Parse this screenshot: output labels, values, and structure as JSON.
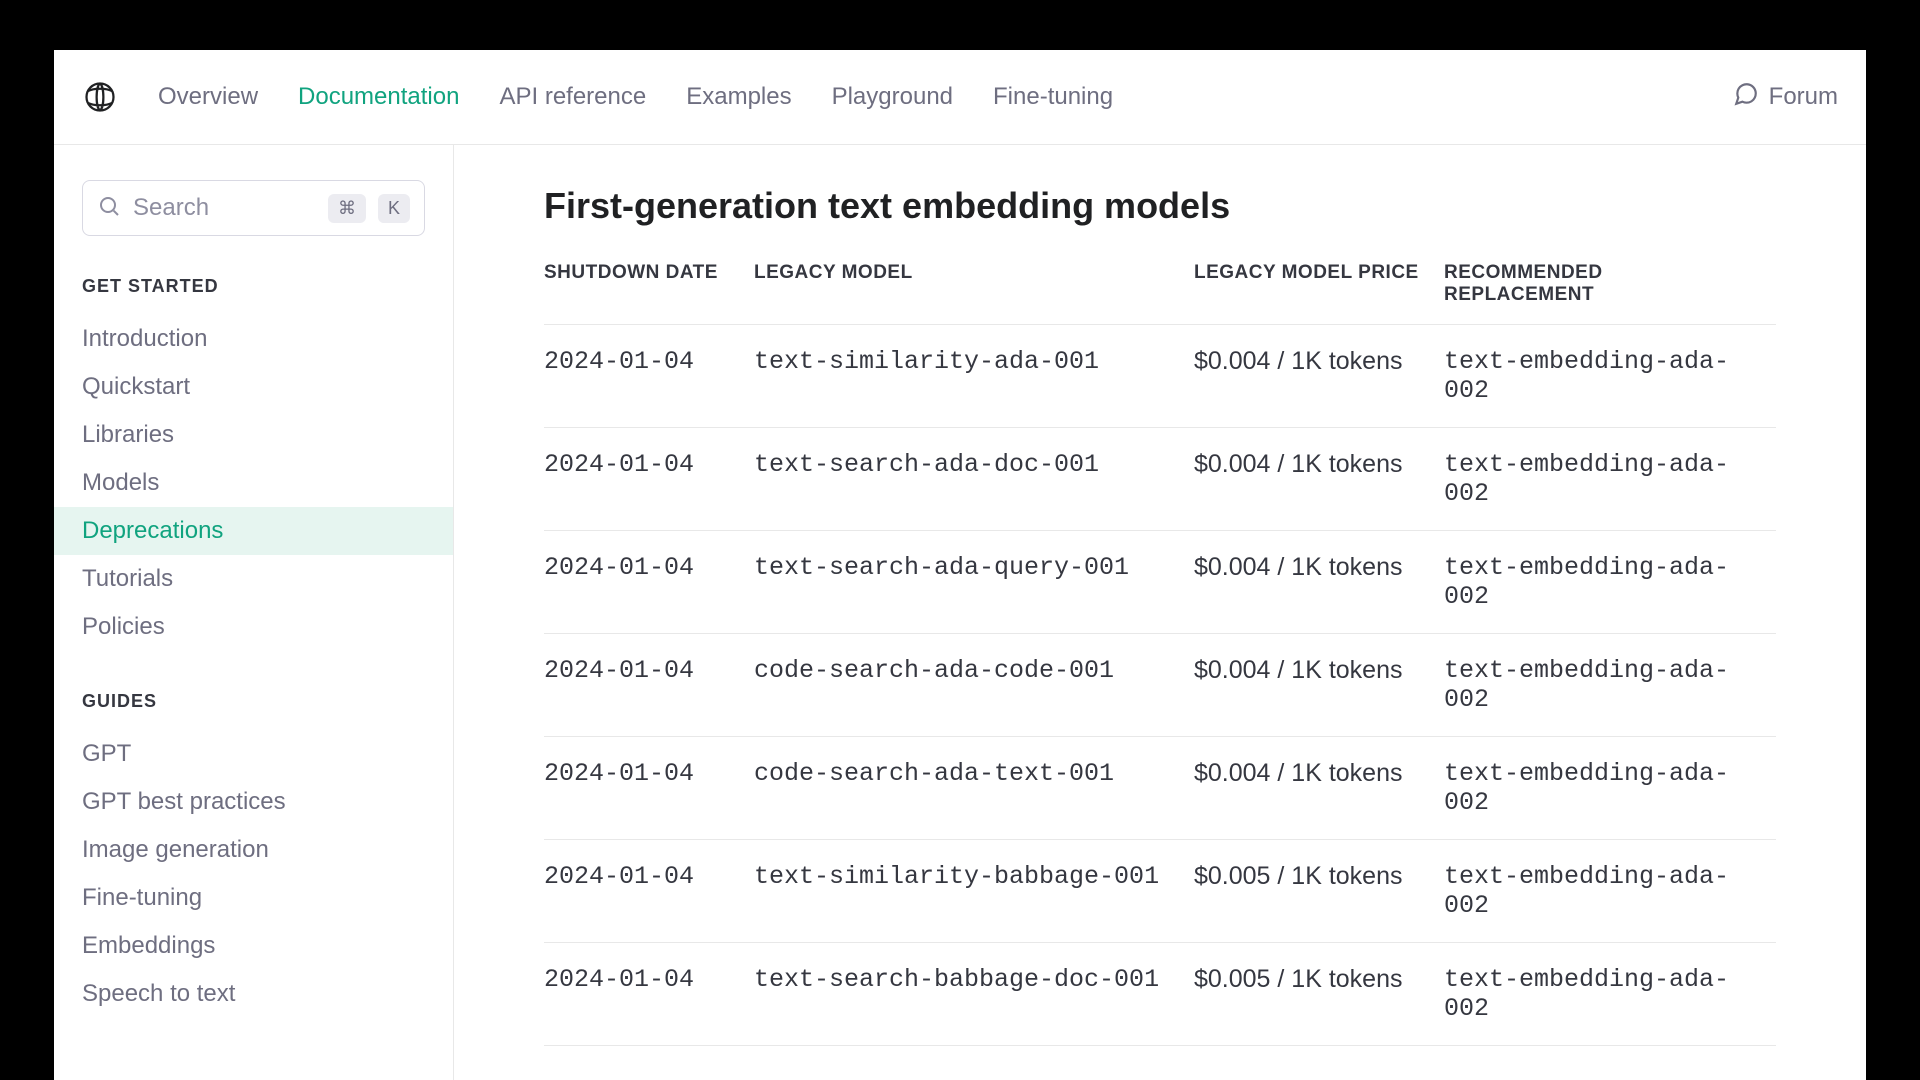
{
  "nav": {
    "items": [
      {
        "label": "Overview",
        "active": false
      },
      {
        "label": "Documentation",
        "active": true
      },
      {
        "label": "API reference",
        "active": false
      },
      {
        "label": "Examples",
        "active": false
      },
      {
        "label": "Playground",
        "active": false
      },
      {
        "label": "Fine-tuning",
        "active": false
      }
    ],
    "forum_label": "Forum"
  },
  "search": {
    "placeholder": "Search",
    "kbd1": "⌘",
    "kbd2": "K"
  },
  "sidebar": {
    "sections": [
      {
        "label": "GET STARTED",
        "items": [
          {
            "label": "Introduction",
            "active": false
          },
          {
            "label": "Quickstart",
            "active": false
          },
          {
            "label": "Libraries",
            "active": false
          },
          {
            "label": "Models",
            "active": false
          },
          {
            "label": "Deprecations",
            "active": true
          },
          {
            "label": "Tutorials",
            "active": false
          },
          {
            "label": "Policies",
            "active": false
          }
        ]
      },
      {
        "label": "GUIDES",
        "items": [
          {
            "label": "GPT",
            "active": false
          },
          {
            "label": "GPT best practices",
            "active": false
          },
          {
            "label": "Image generation",
            "active": false
          },
          {
            "label": "Fine-tuning",
            "active": false
          },
          {
            "label": "Embeddings",
            "active": false
          },
          {
            "label": "Speech to text",
            "active": false
          }
        ]
      }
    ]
  },
  "page": {
    "title": "First-generation text embedding models",
    "columns": [
      "SHUTDOWN DATE",
      "LEGACY MODEL",
      "LEGACY MODEL PRICE",
      "RECOMMENDED REPLACEMENT"
    ],
    "rows": [
      {
        "date": "2024-01-04",
        "model": "text-similarity-ada-001",
        "price": "$0.004 / 1K tokens",
        "replacement": "text-embedding-ada-002"
      },
      {
        "date": "2024-01-04",
        "model": "text-search-ada-doc-001",
        "price": "$0.004 / 1K tokens",
        "replacement": "text-embedding-ada-002"
      },
      {
        "date": "2024-01-04",
        "model": "text-search-ada-query-001",
        "price": "$0.004 / 1K tokens",
        "replacement": "text-embedding-ada-002"
      },
      {
        "date": "2024-01-04",
        "model": "code-search-ada-code-001",
        "price": "$0.004 / 1K tokens",
        "replacement": "text-embedding-ada-002"
      },
      {
        "date": "2024-01-04",
        "model": "code-search-ada-text-001",
        "price": "$0.004 / 1K tokens",
        "replacement": "text-embedding-ada-002"
      },
      {
        "date": "2024-01-04",
        "model": "text-similarity-babbage-001",
        "price": "$0.005 / 1K tokens",
        "replacement": "text-embedding-ada-002"
      },
      {
        "date": "2024-01-04",
        "model": "text-search-babbage-doc-001",
        "price": "$0.005 / 1K tokens",
        "replacement": "text-embedding-ada-002"
      }
    ]
  }
}
